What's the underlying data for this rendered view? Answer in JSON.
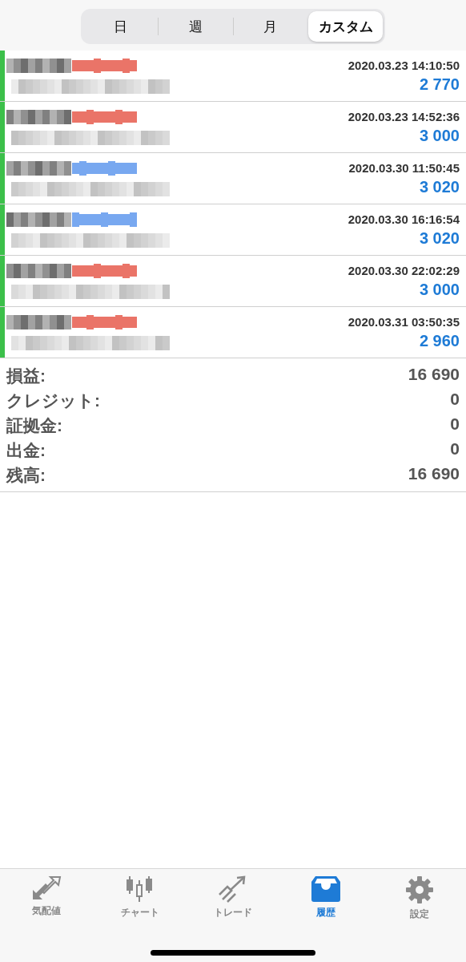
{
  "period_tabs": [
    {
      "label": "日",
      "selected": false
    },
    {
      "label": "週",
      "selected": false
    },
    {
      "label": "月",
      "selected": false
    },
    {
      "label": "カスタム",
      "selected": true
    }
  ],
  "deals": [
    {
      "time": "2020.03.23 14:10:50",
      "profit": "2 770",
      "color": "#ea7468"
    },
    {
      "time": "2020.03.23 14:52:36",
      "profit": "3 000",
      "color": "#ea7468"
    },
    {
      "time": "2020.03.30 11:50:45",
      "profit": "3 020",
      "color": "#78a8f0"
    },
    {
      "time": "2020.03.30 16:16:54",
      "profit": "3 020",
      "color": "#78a8f0"
    },
    {
      "time": "2020.03.30 22:02:29",
      "profit": "3 000",
      "color": "#ea7468"
    },
    {
      "time": "2020.03.31 03:50:35",
      "profit": "2 960",
      "color": "#ea7468"
    }
  ],
  "summary": [
    {
      "label": "損益:",
      "value": "16 690"
    },
    {
      "label": "クレジット:",
      "value": "0"
    },
    {
      "label": "証拠金:",
      "value": "0"
    },
    {
      "label": "出金:",
      "value": "0"
    },
    {
      "label": "残高:",
      "value": "16 690"
    }
  ],
  "tab_bar": [
    {
      "kind": "quotes",
      "label": "気配値",
      "selected": false
    },
    {
      "kind": "chart",
      "label": "チャート",
      "selected": false
    },
    {
      "kind": "trade",
      "label": "トレード",
      "selected": false
    },
    {
      "kind": "history",
      "label": "履歴",
      "selected": true
    },
    {
      "kind": "settings",
      "label": "設定",
      "selected": false
    }
  ]
}
